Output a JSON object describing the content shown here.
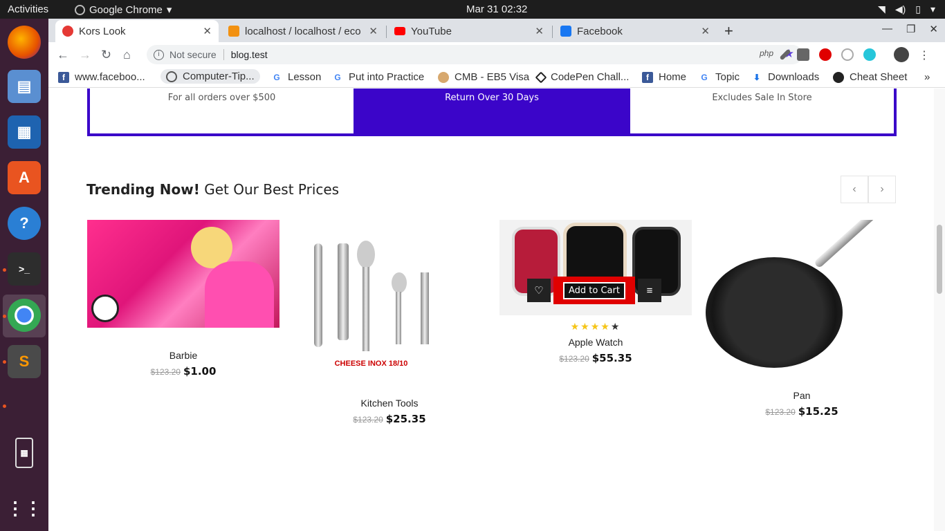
{
  "system": {
    "activities": "Activities",
    "app_name": "Google Chrome",
    "clock": "Mar 31  02:32"
  },
  "browser": {
    "tabs": [
      {
        "title": "Kors Look",
        "icon_color": "#e53935"
      },
      {
        "title": "localhost / localhost / eco",
        "icon_color": "#f29111"
      },
      {
        "title": "YouTube",
        "icon_color": "#ff0000"
      },
      {
        "title": "Facebook",
        "icon_color": "#1877f2"
      }
    ],
    "security": "Not secure",
    "url": "blog.test",
    "bookmarks": [
      {
        "label": "www.faceboo...",
        "icon": "facebook-icon"
      },
      {
        "label": "Computer-Tip...",
        "icon": "cc-icon"
      },
      {
        "label": "Lesson",
        "icon": "google-icon"
      },
      {
        "label": "Put into Practice",
        "icon": "google-icon"
      },
      {
        "label": "CMB - EB5 Visa",
        "icon": "site-icon"
      },
      {
        "label": "CodePen Chall...",
        "icon": "codepen-icon"
      },
      {
        "label": "Home",
        "icon": "facebook-icon"
      },
      {
        "label": "Topic",
        "icon": "google-icon"
      },
      {
        "label": "Downloads",
        "icon": "download-icon"
      },
      {
        "label": "Cheat Sheet",
        "icon": "site-icon"
      }
    ]
  },
  "features": [
    {
      "text": "For all orders over $500"
    },
    {
      "text": "Return Over 30 Days"
    },
    {
      "text": "Excludes Sale In Store"
    }
  ],
  "section": {
    "title_bold": "Trending Now!",
    "title_rest": " Get Our Best Prices",
    "prev": "‹",
    "next": "›"
  },
  "products": [
    {
      "name": "Barbie",
      "old_price": "$123.20",
      "price": "$1.00"
    },
    {
      "name": "Kitchen Tools",
      "old_price": "$123.20",
      "price": "$25.35",
      "image_caption": "CHEESE INOX 18/10"
    },
    {
      "name": "Apple Watch",
      "old_price": "$123.20",
      "price": "$55.35",
      "rating": 4,
      "rating_max": 5,
      "cart_label": "Add to Cart"
    },
    {
      "name": "Pan",
      "old_price": "$123.20",
      "price": "$15.25"
    }
  ],
  "colors": {
    "accent": "#3b05c9",
    "cart": "#e00000"
  }
}
